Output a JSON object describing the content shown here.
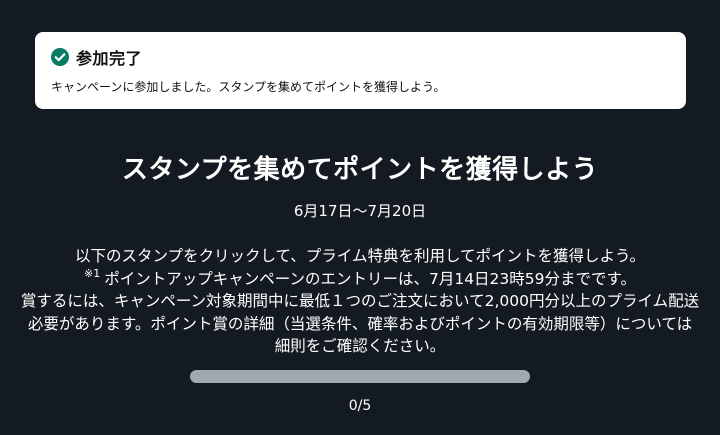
{
  "alert": {
    "title": "参加完了",
    "message": "キャンペーンに参加しました。スタンプを集めてポイントを獲得しよう。",
    "icon": "check-circle-icon",
    "icon_color": "#067d62"
  },
  "campaign": {
    "title": "スタンプを集めてポイントを獲得しよう",
    "date_range": "6月17日～7月20日",
    "description_lines": [
      "以下のスタンプをクリックして、プライム特典を利用してポイントを獲得しよう。",
      "ポイントアップキャンペーンのエントリーは、7月14日23時59分までです。",
      "賞するには、キャンペーン対象期間中に最低１つのご注文において2,000円分以上のプライム配送",
      "必要があります。ポイント賞の詳細（当選条件、確率およびポイントの有効期限等）については",
      "細則をご確認ください。"
    ],
    "note_mark": "※1"
  },
  "progress": {
    "label": "0/5",
    "collected": 0,
    "total": 5,
    "fill_color": "#5b8db4",
    "track_color": "#a2a8b0"
  },
  "colors": {
    "background": "#141a21",
    "text": "#ffffff",
    "alert_background": "#ffffff"
  }
}
